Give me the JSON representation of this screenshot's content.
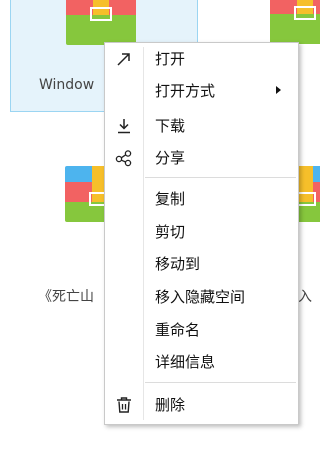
{
  "files": [
    {
      "name": "Window",
      "selected": true
    },
    {
      "name": "",
      "selected": false
    },
    {
      "name": "《死亡山",
      "selected": false
    },
    {
      "name": "入",
      "selected": false
    }
  ],
  "menu": {
    "items": [
      {
        "id": "open",
        "label": "打开",
        "icon": "arrow-up-right-icon"
      },
      {
        "id": "open-with",
        "label": "打开方式",
        "has_submenu": true
      },
      {
        "id": "download",
        "label": "下载",
        "icon": "download-icon"
      },
      {
        "id": "share",
        "label": "分享",
        "icon": "share-icon"
      },
      {
        "id": "copy",
        "label": "复制"
      },
      {
        "id": "cut",
        "label": "剪切"
      },
      {
        "id": "move-to",
        "label": "移动到"
      },
      {
        "id": "move-to-hidden",
        "label": "移入隐藏空间"
      },
      {
        "id": "rename",
        "label": "重命名"
      },
      {
        "id": "details",
        "label": "详细信息"
      },
      {
        "id": "delete",
        "label": "删除",
        "icon": "trash-icon"
      }
    ]
  },
  "colors": {
    "icon_blue": "#4db4ee",
    "icon_yellow": "#f6bf2a",
    "icon_red": "#f26262",
    "icon_green": "#86c73d",
    "selection_bg": "#e5f3fb",
    "selection_border": "#9bd5f2"
  }
}
